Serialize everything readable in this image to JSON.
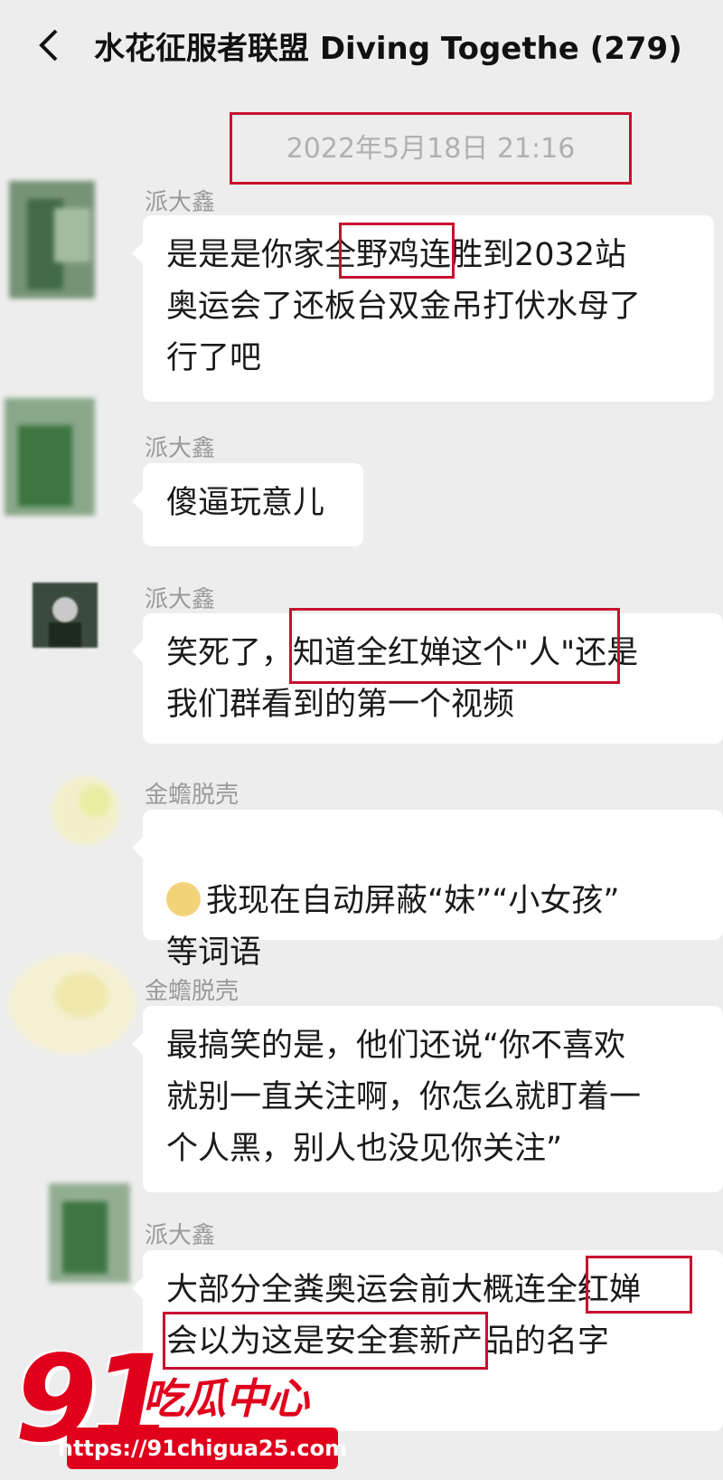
{
  "header": {
    "title": "水花征服者联盟 Diving Togethe (279)"
  },
  "timestamp": "2022年5月18日 21:16",
  "messages": [
    {
      "sender": "派大鑫",
      "text": "是是是你家全野鸡连胜到2032站\n奥运会了还板台双金吊打伏水母了\n行了吧"
    },
    {
      "sender": "派大鑫",
      "text": "傻逼玩意儿"
    },
    {
      "sender": "派大鑫",
      "text": "笑死了，知道全红婵这个\"人\"还是\n我们群看到的第一个视频"
    },
    {
      "sender": "金蟾脱壳",
      "text": "我现在自动屏蔽“妹”“小女孩”\n等词语"
    },
    {
      "sender": "金蟾脱壳",
      "text": "最搞笑的是，他们还说“你不喜欢\n就别一直关注啊，你怎么就盯着一\n个人黑，别人也没见你关注”"
    },
    {
      "sender": "派大鑫",
      "text": "大部分全粪奥运会前大概连全红婵\n会以为这是安全套新产品的名字"
    }
  ],
  "watermark": {
    "number": "91",
    "text": "吃瓜中心",
    "url": "https://91chigua25.com"
  },
  "colors": {
    "background": "#ededed",
    "bubble": "#ffffff",
    "highlight": "#c8102e",
    "watermark": "#e0001b"
  }
}
